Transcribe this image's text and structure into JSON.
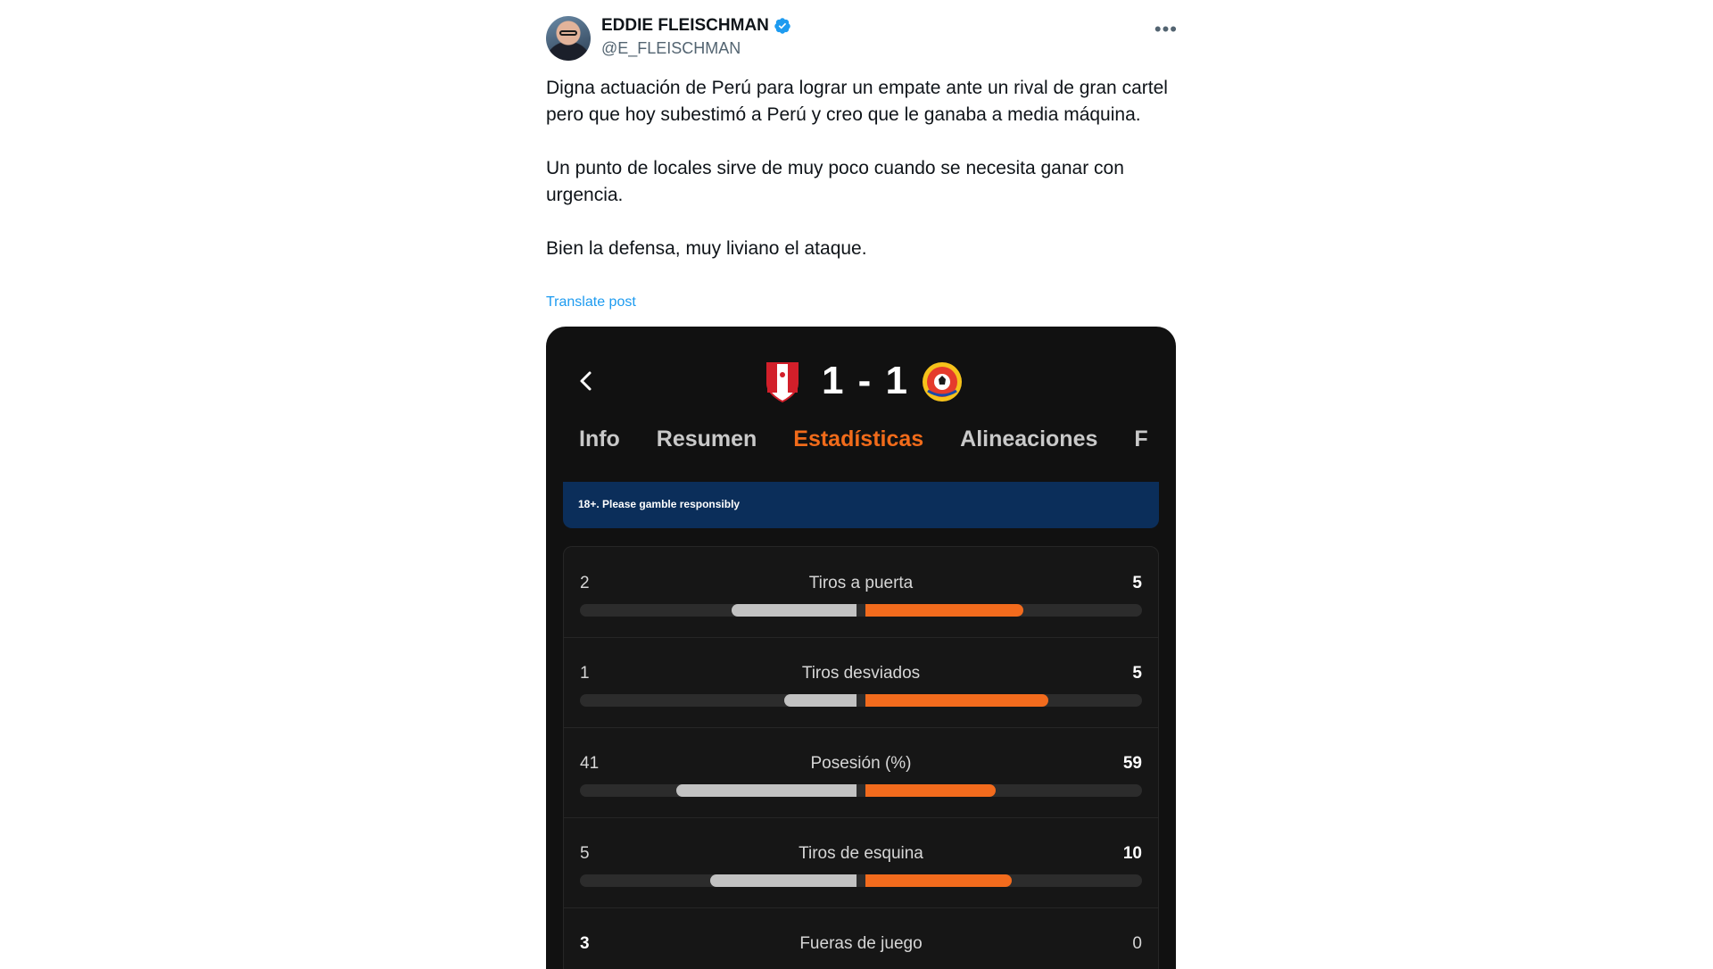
{
  "author": {
    "name": "EDDIE FLEISCHMAN",
    "handle": "@E_FLEISCHMAN",
    "verified": true
  },
  "post": {
    "paragraphs": [
      "Digna actuación de Perú para lograr un empate ante un rival de gran cartel pero que hoy subestimó a Perú y creo que le ganaba a media máquina.",
      "Un punto de locales sirve de muy poco cuando se necesita ganar con urgencia.",
      "Bien la defensa, muy liviano el ataque."
    ],
    "translate_label": "Translate post",
    "more_icon": "•••"
  },
  "match": {
    "score": "1 - 1",
    "home_team_icon": "peru-fpf-crest",
    "away_team_icon": "colombia-fcf-crest",
    "tabs": [
      "Info",
      "Resumen",
      "Estadísticas",
      "Alineaciones",
      "F"
    ],
    "active_tab": "Estadísticas",
    "banner": "18+. Please gamble responsibly",
    "stats": [
      {
        "label": "Tiros a puerta",
        "home": "2",
        "away": "5",
        "home_fill": 0.45,
        "away_fill": 0.57
      },
      {
        "label": "Tiros desviados",
        "home": "1",
        "away": "5",
        "home_fill": 0.26,
        "away_fill": 0.66
      },
      {
        "label": "Posesión (%)",
        "home": "41",
        "away": "59",
        "home_fill": 0.65,
        "away_fill": 0.47
      },
      {
        "label": "Tiros de esquina",
        "home": "5",
        "away": "10",
        "home_fill": 0.53,
        "away_fill": 0.53
      },
      {
        "label": "Fueras de juego",
        "home": "3",
        "away": "0",
        "home_fill": 0,
        "away_fill": 0
      }
    ]
  },
  "colors": {
    "accent": "#f16b1a",
    "link": "#1d9bf0",
    "verified": "#1d9bf0"
  }
}
